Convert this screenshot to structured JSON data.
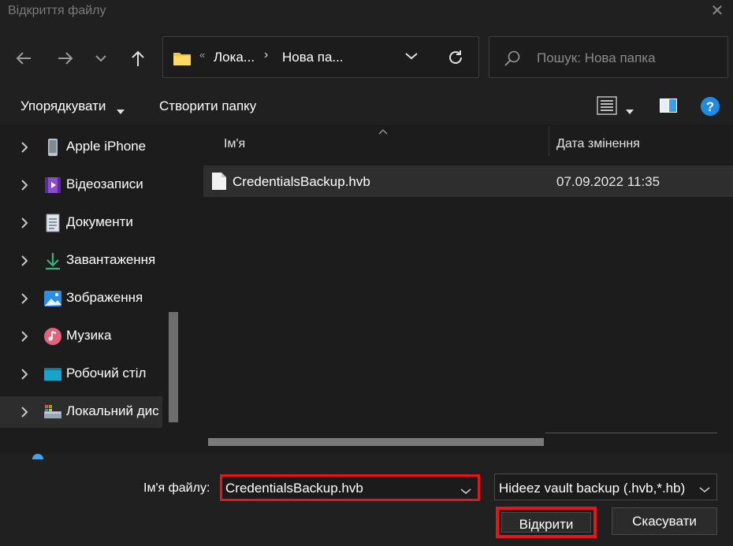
{
  "window": {
    "title": "Відкриття файлу"
  },
  "navigation": {
    "breadcrumb": [
      "Лока...",
      "Нова па..."
    ],
    "overflow": "«",
    "search_placeholder": "Пошук: Нова папка"
  },
  "toolbar": {
    "organize_label": "Упорядкувати",
    "new_folder_label": "Створити папку"
  },
  "sidebar": {
    "items": [
      {
        "label": "Apple iPhone",
        "icon": "iphone-icon"
      },
      {
        "label": "Відеозаписи",
        "icon": "videos-icon"
      },
      {
        "label": "Документи",
        "icon": "documents-icon"
      },
      {
        "label": "Завантаження",
        "icon": "downloads-icon"
      },
      {
        "label": "Зображення",
        "icon": "pictures-icon"
      },
      {
        "label": "Музика",
        "icon": "music-icon"
      },
      {
        "label": "Робочий стіл",
        "icon": "desktop-icon"
      },
      {
        "label": "Локальний дис",
        "icon": "local-disk-icon",
        "selected": true
      }
    ]
  },
  "file_list": {
    "columns": {
      "name": "Ім'я",
      "modified": "Дата змінення"
    },
    "rows": [
      {
        "name": "CredentialsBackup.hvb",
        "modified": "07.09.2022 11:35"
      }
    ]
  },
  "footer": {
    "filename_label": "Ім'я файлу:",
    "filename_value": "CredentialsBackup.hvb",
    "filter_value": "Hideez vault backup (.hvb,*.hb)",
    "open_label": "Відкрити",
    "cancel_label": "Скасувати"
  },
  "colors": {
    "highlight_border": "#e8141b",
    "background": "#1c1c1c",
    "folder_yellow": "#f5c342"
  }
}
